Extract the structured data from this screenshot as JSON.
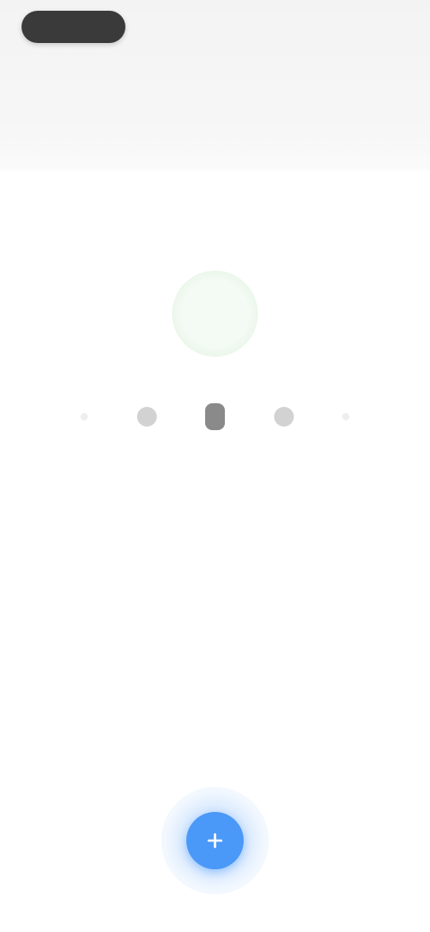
{
  "top_bar": {
    "pill_label": "",
    "right_label": ""
  },
  "tabs_row1": [
    {
      "label": ""
    },
    {
      "label": ""
    },
    {
      "label": ""
    }
  ],
  "tabs_row2": [
    {
      "label": ""
    },
    {
      "label": ""
    }
  ],
  "picker": {
    "items": [
      {
        "label": ""
      },
      {
        "label": ""
      },
      {
        "label": ""
      },
      {
        "label": ""
      },
      {
        "label": ""
      }
    ],
    "selected_index": 2
  },
  "caption": "",
  "fab": {
    "icon": "plus-icon",
    "color": "#4a98f7"
  },
  "colors": {
    "accent": "#4a98f7",
    "selection_glow": "#e9f6e9",
    "pill": "#3a3a3a"
  }
}
